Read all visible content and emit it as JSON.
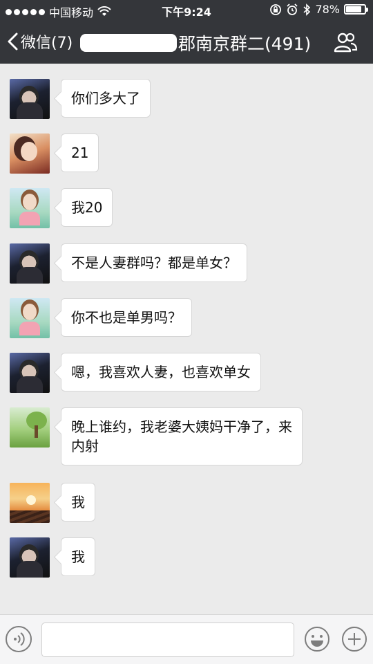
{
  "status_bar": {
    "carrier": "中国移动",
    "time": "下午9:24",
    "battery": "78%",
    "battery_level": 0.78
  },
  "nav": {
    "back_label": "微信(7)",
    "title_visible": "郡南京群二(491)"
  },
  "messages": [
    {
      "avatar": "boy",
      "text": "你们多大了"
    },
    {
      "avatar": "girl1",
      "text": "21"
    },
    {
      "avatar": "girl2",
      "text": "我20"
    },
    {
      "avatar": "boy",
      "text": "不是人妻群吗？都是单女？"
    },
    {
      "avatar": "girl2",
      "text": "你不也是单男吗？"
    },
    {
      "avatar": "boy",
      "text": "嗯，我喜欢人妻，也喜欢单女"
    },
    {
      "avatar": "tree",
      "text": "晚上谁约，我老婆大姨妈干净了，来内射"
    },
    {
      "avatar": "sunset",
      "text": "我"
    },
    {
      "avatar": "boy",
      "text": "我"
    }
  ],
  "input": {
    "placeholder": ""
  },
  "icons": {
    "back": "chevron-left-icon",
    "group": "group-members-icon",
    "voice": "voice-input-icon",
    "emoji": "emoji-icon",
    "plus": "plus-icon"
  }
}
